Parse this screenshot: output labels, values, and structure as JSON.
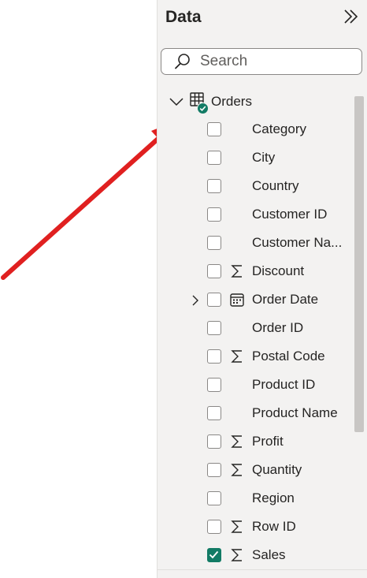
{
  "pane": {
    "title": "Data",
    "search_placeholder": "Search"
  },
  "table": {
    "name": "Orders",
    "icon": "table-icon",
    "badge_icon": "check-badge-icon"
  },
  "fields": [
    {
      "name": "Category",
      "icon": "",
      "checked": false
    },
    {
      "name": "City",
      "icon": "",
      "checked": false
    },
    {
      "name": "Country",
      "icon": "",
      "checked": false
    },
    {
      "name": "Customer ID",
      "icon": "",
      "checked": false
    },
    {
      "name": "Customer Na...",
      "icon": "",
      "checked": false
    },
    {
      "name": "Discount",
      "icon": "sigma-icon",
      "checked": false
    },
    {
      "name": "Order Date",
      "icon": "calendar-icon",
      "checked": false,
      "expandable": true
    },
    {
      "name": "Order ID",
      "icon": "",
      "checked": false
    },
    {
      "name": "Postal Code",
      "icon": "sigma-icon",
      "checked": false
    },
    {
      "name": "Product ID",
      "icon": "",
      "checked": false
    },
    {
      "name": "Product Name",
      "icon": "",
      "checked": false
    },
    {
      "name": "Profit",
      "icon": "sigma-icon",
      "checked": false
    },
    {
      "name": "Quantity",
      "icon": "sigma-icon",
      "checked": false
    },
    {
      "name": "Region",
      "icon": "",
      "checked": false
    },
    {
      "name": "Row ID",
      "icon": "sigma-icon",
      "checked": false
    },
    {
      "name": "Sales",
      "icon": "sigma-icon",
      "checked": true
    }
  ],
  "colors": {
    "accent": "#127b65",
    "annotation_arrow": "#e02020",
    "pane_bg": "#f3f2f1"
  }
}
